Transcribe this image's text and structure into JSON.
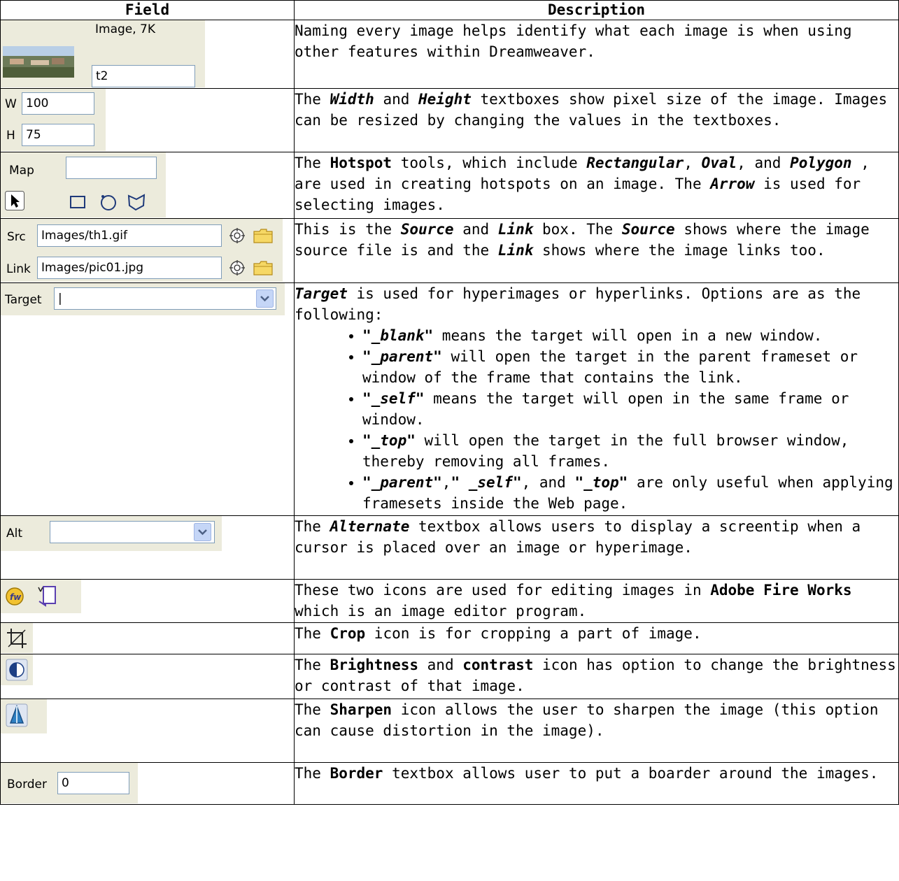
{
  "table": {
    "header_field": "Field",
    "header_description": "Description"
  },
  "rows": {
    "image": {
      "size_label": "Image, 7K",
      "name_value": "t2",
      "desc": "Naming every image helps identify what each image is when using other features within Dreamweaver."
    },
    "dimensions": {
      "w_label": "W",
      "w_value": "100",
      "h_label": "H",
      "h_value": "75",
      "d1": "The ",
      "b1": "Width",
      "d2": " and ",
      "b2": "Height",
      "d3": " textboxes show pixel size of the image. Images can be resized by changing the values in the textboxes."
    },
    "map": {
      "label": "Map",
      "value": "",
      "d1": "The ",
      "b1": "Hotspot",
      "d2": " tools, which include ",
      "bi1": "Rectangular",
      "d3": ", ",
      "bi2": "Oval",
      "d4": ", and ",
      "bi3": "Polygon",
      "d5": " , are used in creating hotspots on an image. The ",
      "bi4": "Arrow",
      "d6": " is used for selecting images."
    },
    "source": {
      "src_label": "Src",
      "src_value": "Images/th1.gif",
      "link_label": "Link",
      "link_value": "Images/pic01.jpg",
      "d1": "This is the ",
      "bi1": "Source",
      "d2": " and ",
      "bi2": "Link",
      "d3": " box. The ",
      "bi3": "Source",
      "d4": " shows where the image source file is and the ",
      "bi4": "Link",
      "d5": " shows where the image links too."
    },
    "target": {
      "label": "Target",
      "value": "|",
      "bi1": "Target",
      "d1": " is used for hyperimages or hyperlinks. Options are as the following:",
      "items": [
        {
          "b": "\"_blank\"",
          "t": " means the target will open in a new window."
        },
        {
          "b": "\"_parent\"",
          "t": " will open the target in the parent frameset or window of the frame that contains the link."
        },
        {
          "b": "\"_self\"",
          "t": " means the target will open in the same frame or window."
        },
        {
          "b": "\"_top\"",
          "t": " will open the target in the full browser window, thereby removing all frames."
        }
      ],
      "last_b1": "\"_parent\"",
      "last_c1": ",",
      "last_b2": "\" _self\"",
      "last_c2": ", and ",
      "last_b3": "\"_top\"",
      "last_t": " are only useful when applying framesets inside the Web page."
    },
    "alt": {
      "label": "Alt",
      "value": "",
      "d1": "The ",
      "bi1": "Alternate",
      "d2": " textbox allows users to display a screentip when a cursor is placed over an image or hyperimage."
    },
    "fireworks": {
      "d1": "These two icons are used for editing images in ",
      "b1": "Adobe Fire Works",
      "d2": " which is an image editor program."
    },
    "crop": {
      "d1": "The ",
      "b1": "Crop",
      "d2": " icon is for cropping a part of image."
    },
    "brightness": {
      "d1": "The ",
      "b1": "Brightness",
      "d2": " and ",
      "b2": "contrast",
      "d3": " icon has option to change the brightness or contrast of that image."
    },
    "sharpen": {
      "d1": "The ",
      "b1": "Sharpen",
      "d2": " icon allows the user to sharpen the image (this option can cause distortion in the image)."
    },
    "border": {
      "label": "Border",
      "value": "0",
      "d1": "The ",
      "b1": "Border",
      "d2": " textbox allows user to put a boarder around the images."
    }
  }
}
